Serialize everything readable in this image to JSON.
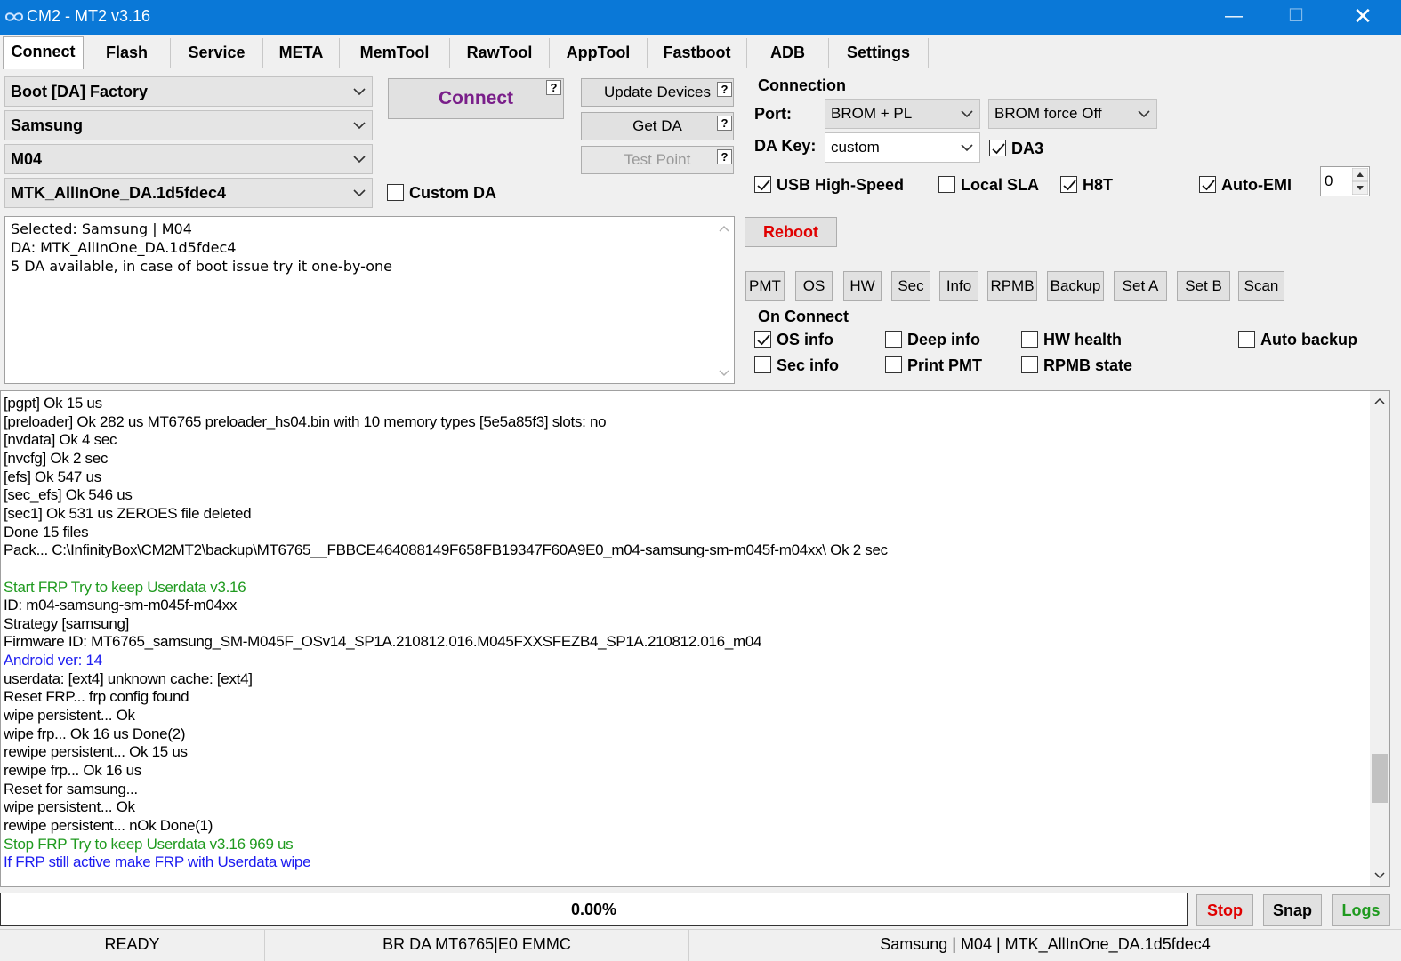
{
  "window": {
    "title": "CM2 - MT2 v3.16"
  },
  "tabs": [
    "Connect",
    "Flash",
    "Service",
    "META",
    "MemTool",
    "RawTool",
    "AppTool",
    "Fastboot",
    "ADB",
    "Settings"
  ],
  "selectors": {
    "boot": "Boot [DA] Factory",
    "brand": "Samsung",
    "model": "M04",
    "da_file": "MTK_AllInOne_DA.1d5fdec4"
  },
  "buttons": {
    "connect": "Connect",
    "update_devices": "Update Devices",
    "get_da": "Get DA",
    "test_point": "Test Point",
    "help": "?",
    "reboot": "Reboot"
  },
  "custom_da": {
    "label": "Custom DA",
    "checked": false
  },
  "info_box": [
    "Selected: Samsung | M04",
    "DA: MTK_AllInOne_DA.1d5fdec4",
    "5 DA available, in case of boot issue try it one-by-one"
  ],
  "connection": {
    "title": "Connection",
    "port_label": "Port:",
    "port_value": "BROM + PL",
    "brom_value": "BROM force Off",
    "dakey_label": "DA Key:",
    "dakey_value": "custom",
    "da3": {
      "label": "DA3",
      "checked": true
    },
    "usb_high_speed": {
      "label": "USB High-Speed",
      "checked": true
    },
    "local_sla": {
      "label": "Local SLA",
      "checked": false
    },
    "h8t": {
      "label": "H8T",
      "checked": true
    },
    "auto_emi": {
      "label": "Auto-EMI",
      "checked": true
    },
    "emi_value": "0"
  },
  "action_buttons": [
    "PMT",
    "OS",
    "HW",
    "Sec",
    "Info",
    "RPMB",
    "Backup",
    "Set A",
    "Set B",
    "Scan"
  ],
  "on_connect": {
    "title": "On Connect",
    "os_info": {
      "label": "OS info",
      "checked": true
    },
    "deep_info": {
      "label": "Deep info",
      "checked": false
    },
    "hw_health": {
      "label": "HW health",
      "checked": false
    },
    "auto_backup": {
      "label": "Auto backup",
      "checked": false
    },
    "sec_info": {
      "label": "Sec info",
      "checked": false
    },
    "print_pmt": {
      "label": "Print PMT",
      "checked": false
    },
    "rpmb_state": {
      "label": "RPMB state",
      "checked": false
    }
  },
  "colors": {
    "green": "#1f9a1f",
    "blue": "#1c1cf0",
    "red": "#e00000",
    "purple": "#7a1f8a"
  },
  "log": [
    {
      "text": "[pgpt] Ok 15 us",
      "color": ""
    },
    {
      "text": "[preloader] Ok 282 us MT6765 preloader_hs04.bin with 10 memory types [5e5a85f3] slots: no",
      "color": ""
    },
    {
      "text": "[nvdata] Ok 4 sec",
      "color": ""
    },
    {
      "text": "[nvcfg] Ok 2 sec",
      "color": ""
    },
    {
      "text": "[efs] Ok 547 us",
      "color": ""
    },
    {
      "text": "[sec_efs] Ok 546 us",
      "color": ""
    },
    {
      "text": "[sec1] Ok 531 us ZEROES file deleted",
      "color": ""
    },
    {
      "text": "Done 15 files",
      "color": ""
    },
    {
      "text": "Pack... C:\\InfinityBox\\CM2MT2\\backup\\MT6765__FBBCE464088149F658FB19347F60A9E0_m04-samsung-sm-m045f-m04xx\\ Ok 2 sec",
      "color": ""
    },
    {
      "text": "",
      "color": ""
    },
    {
      "text": "Start FRP Try to keep Userdata v3.16",
      "color": "green"
    },
    {
      "text": "ID: m04-samsung-sm-m045f-m04xx",
      "color": ""
    },
    {
      "text": "Strategy [samsung]",
      "color": ""
    },
    {
      "text": "Firmware ID: MT6765_samsung_SM-M045F_OSv14_SP1A.210812.016.M045FXXSFEZB4_SP1A.210812.016_m04",
      "color": ""
    },
    {
      "text": "Android ver: 14",
      "color": "blue"
    },
    {
      "text": "userdata: [ext4] unknown cache: [ext4]",
      "color": ""
    },
    {
      "text": "Reset FRP... frp config found",
      "color": ""
    },
    {
      "text": "wipe persistent... Ok",
      "color": ""
    },
    {
      "text": "wipe frp... Ok 16 us Done(2)",
      "color": ""
    },
    {
      "text": "rewipe persistent... Ok 15 us",
      "color": ""
    },
    {
      "text": "rewipe frp... Ok 16 us",
      "color": ""
    },
    {
      "text": "Reset for samsung...",
      "color": ""
    },
    {
      "text": "wipe persistent... Ok",
      "color": ""
    },
    {
      "text": "rewipe persistent... nOk Done(1)",
      "color": ""
    },
    {
      "text": "Stop FRP Try to keep Userdata v3.16 969 us",
      "color": "green"
    },
    {
      "text": "If FRP still active make FRP with Userdata wipe",
      "color": "blue"
    }
  ],
  "progress": {
    "text": "0.00%",
    "value": 0
  },
  "bottom_buttons": {
    "stop": "Stop",
    "snap": "Snap",
    "logs": "Logs"
  },
  "status_bar": [
    "READY",
    "BR DA MT6765|E0 EMMC",
    "Samsung | M04 | MTK_AllInOne_DA.1d5fdec4"
  ]
}
